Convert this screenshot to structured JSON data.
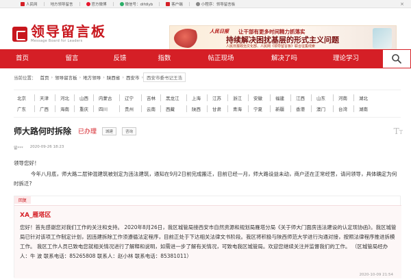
{
  "topbar": {
    "links": [
      {
        "label": "人民网",
        "icon": "people-daily-icon",
        "color": "#d51f26"
      },
      {
        "label": "地方领导留言",
        "icon": null,
        "color": null
      },
      {
        "label": "官方微博",
        "icon": "weibo-icon",
        "color": "#e6162d"
      },
      {
        "label": "微信号：difdlyb",
        "icon": "wechat-icon",
        "color": "#2aae67"
      },
      {
        "label": "客户端",
        "icon": "app-client-icon",
        "color": "#d51f26"
      },
      {
        "label": "小程序：领导留言板",
        "icon": "mini-program-icon",
        "color": "#666666"
      }
    ],
    "close": "×"
  },
  "logo": {
    "title": "领导留言板",
    "subtitle": "Message Board for Leaders"
  },
  "banner": {
    "brand": "人民日报",
    "top_line": "让干部有更多时间精力抓落实",
    "main_line": "持续解决困扰基层的形式主义问题",
    "foot_line": "人民日报政治文化部、人民网《领导留言板》联合征集线索"
  },
  "nav": {
    "items": [
      "首页",
      "留言",
      "反馈",
      "指数",
      "帖正现场",
      "解决了吗",
      "理论学习"
    ]
  },
  "breadcrumb": {
    "prefix": "当前位置：",
    "items": [
      "首页",
      "领导留言板",
      "地方领导",
      "陕西省",
      "西安市",
      "西安市委书记王浩"
    ]
  },
  "regions": {
    "row1": [
      "北京",
      "天津",
      "河北",
      "山西",
      "内蒙古",
      "辽宁",
      "吉林",
      "黑龙江",
      "上海",
      "江苏",
      "浙江",
      "安徽",
      "福建",
      "江西",
      "山东",
      "河南",
      "湖北"
    ],
    "row2": [
      "广东",
      "广西",
      "海南",
      "重庆",
      "四川",
      "贵州",
      "云南",
      "西藏",
      "陕西",
      "甘肃",
      "青海",
      "宁夏",
      "新疆",
      "香港",
      "澳门",
      "台湾",
      "湖南"
    ]
  },
  "message": {
    "title": "师大路何时拆除",
    "status": "已办理",
    "tags": [
      "城建",
      "咨询"
    ],
    "author": "留***",
    "date": "2020-09-26 18:23",
    "greeting": "领导您好！",
    "body": "今年八月底，师大路二层钟混建筑被划定为违法建筑，通知在9月2日前完成搬迁，目前已经一月，师大路设益未动，商户还在正常经营，请问领导，具体确定为何时拆迁?"
  },
  "reply": {
    "label": "回复",
    "org": "XA_雁塔区",
    "body": "您好！首先感谢您对我们工作的关注和支持。 2020年8月26日，我区城管局接西安市自然资源和规划局雁塔分局《关于师大门面房违法建设的认定现协函》。我区城管局已针对该项工作制定计划，因违建拆除工作须遵循法定程序，目前正处于下达相关法律文书阶段。我区将积极与陕西师范大学进行沟通对接，按照法律程序推进拆模工作。 我区工作人员已致电您就相关情况进行了解释和说明，如需进一步了解有关情况，可致电我区城管局。欢迎您继续关注并监督我们的工作。 （区城管局经办人：牛 波 联系电话：85265808 联系人：赵小林 联系电话：85381011）",
    "time": "2020-10-09 21:54"
  },
  "colors": {
    "brand_red": "#d51f26"
  }
}
